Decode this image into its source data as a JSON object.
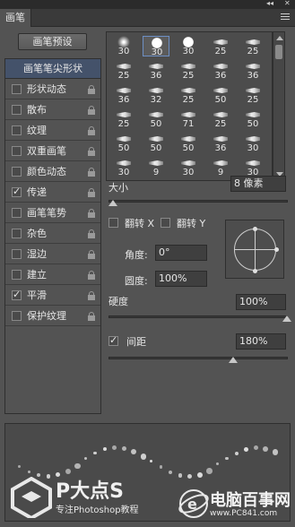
{
  "window": {
    "panel_tab": "画笔",
    "top_controls": "◂◂ ✕"
  },
  "left": {
    "presets_button": "画笔预设",
    "tip_shape_label": "画笔笔尖形状",
    "options": [
      {
        "label": "形状动态",
        "checked": false,
        "locked": true
      },
      {
        "label": "散布",
        "checked": false,
        "locked": true
      },
      {
        "label": "纹理",
        "checked": false,
        "locked": true
      },
      {
        "label": "双重画笔",
        "checked": false,
        "locked": true
      },
      {
        "label": "颜色动态",
        "checked": false,
        "locked": true
      },
      {
        "label": "传递",
        "checked": true,
        "locked": true
      },
      {
        "label": "画笔笔势",
        "checked": false,
        "locked": true
      },
      {
        "label": "杂色",
        "checked": false,
        "locked": true
      },
      {
        "label": "湿边",
        "checked": false,
        "locked": true
      },
      {
        "label": "建立",
        "checked": false,
        "locked": true
      },
      {
        "label": "平滑",
        "checked": true,
        "locked": true
      },
      {
        "label": "保护纹理",
        "checked": false,
        "locked": true
      }
    ]
  },
  "brushes": [
    [
      "30",
      "30",
      "30",
      "25",
      "25"
    ],
    [
      "25",
      "36",
      "25",
      "36",
      "36"
    ],
    [
      "36",
      "32",
      "25",
      "50",
      "25"
    ],
    [
      "25",
      "50",
      "71",
      "25",
      "50"
    ],
    [
      "50",
      "50",
      "50",
      "36",
      "30"
    ],
    [
      "30",
      "9",
      "30",
      "9",
      "30"
    ]
  ],
  "settings": {
    "size_label": "大小",
    "size_value": "8 像素",
    "flip_x_label": "翻转 X",
    "flip_y_label": "翻转 Y",
    "angle_label": "角度:",
    "angle_value": "0°",
    "roundness_label": "圆度:",
    "roundness_value": "100%",
    "hardness_label": "硬度",
    "hardness_value": "100%",
    "spacing_label": "间距",
    "spacing_value": "180%",
    "spacing_checked": true
  },
  "watermark": {
    "ps_brand": "P大点S",
    "ps_sub": "专注Photoshop教程",
    "pc_brand": "电脑百事网",
    "pc_url": "www.PC841.com"
  },
  "colors": {
    "panel_bg": "#535353",
    "selection": "#44526a"
  }
}
